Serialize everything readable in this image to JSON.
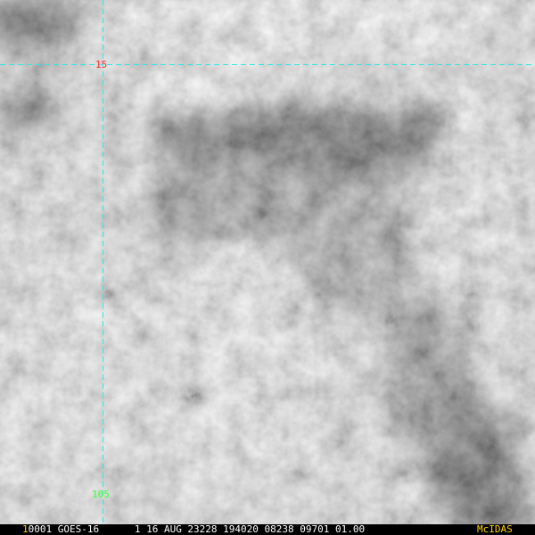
{
  "image": {
    "description_colors": {
      "cloud_bright": "#f2f2f2",
      "cloud_mid": "#c8c8c8",
      "cloud_dark": "#4a4a4a",
      "gridline": "#33e6e6"
    }
  },
  "grid": {
    "latitude_label": "15",
    "longitude_label": "105",
    "latitude_label_color": "#ff3030",
    "longitude_label_color": "#3cff3c"
  },
  "status_bar": {
    "frame_number": "1",
    "info": "0001 GOES-16      1 16 AUG 23228 194020 08238 09701 01.00",
    "brand": "McIDAS"
  }
}
